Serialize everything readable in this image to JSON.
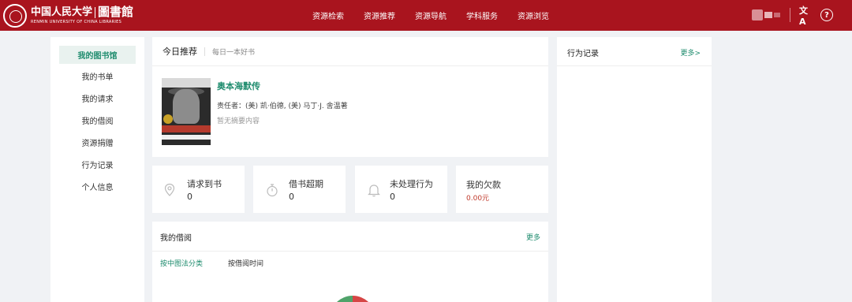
{
  "header": {
    "logo": {
      "cn_name": "中国人民大学",
      "library": "圖書館",
      "en_name": "RENMIN UNIVERSITY OF CHINA LIBRARIES"
    },
    "nav": [
      "资源检索",
      "资源推荐",
      "资源导航",
      "学科服务",
      "资源浏览"
    ],
    "icons": {
      "translate": "文A",
      "help": "?"
    }
  },
  "sidebar": {
    "items": [
      {
        "label": "我的图书馆",
        "active": true
      },
      {
        "label": "我的书单",
        "active": false
      },
      {
        "label": "我的请求",
        "active": false
      },
      {
        "label": "我的借阅",
        "active": false
      },
      {
        "label": "资源捐赠",
        "active": false
      },
      {
        "label": "行为记录",
        "active": false
      },
      {
        "label": "个人信息",
        "active": false
      }
    ]
  },
  "recommend": {
    "title": "今日推荐",
    "subtitle": "每日一本好书",
    "book": {
      "title": "奥本海默传",
      "author": "责任者：(美) 凯·伯德, (美) 马丁·J. 舍温著",
      "abstract": "暂无摘要内容"
    }
  },
  "stats": [
    {
      "label": "请求到书",
      "value": "0",
      "icon": "location-pin-icon"
    },
    {
      "label": "借书超期",
      "value": "0",
      "icon": "stopwatch-icon"
    },
    {
      "label": "未处理行为",
      "value": "0",
      "icon": "bell-icon"
    },
    {
      "label": "我的欠款",
      "value": "0.00元",
      "icon": null
    }
  ],
  "borrow": {
    "title": "我的借阅",
    "more": "更多",
    "tabs": [
      {
        "label": "按中图法分类",
        "active": true
      },
      {
        "label": "按借阅时间",
        "active": false
      }
    ]
  },
  "log": {
    "title": "行为记录",
    "more": "更多>"
  },
  "colors": {
    "header_bg": "#a9141e",
    "accent": "#1f8c6e",
    "debt": "#c0392b",
    "page_bg": "#f0f2f5"
  }
}
